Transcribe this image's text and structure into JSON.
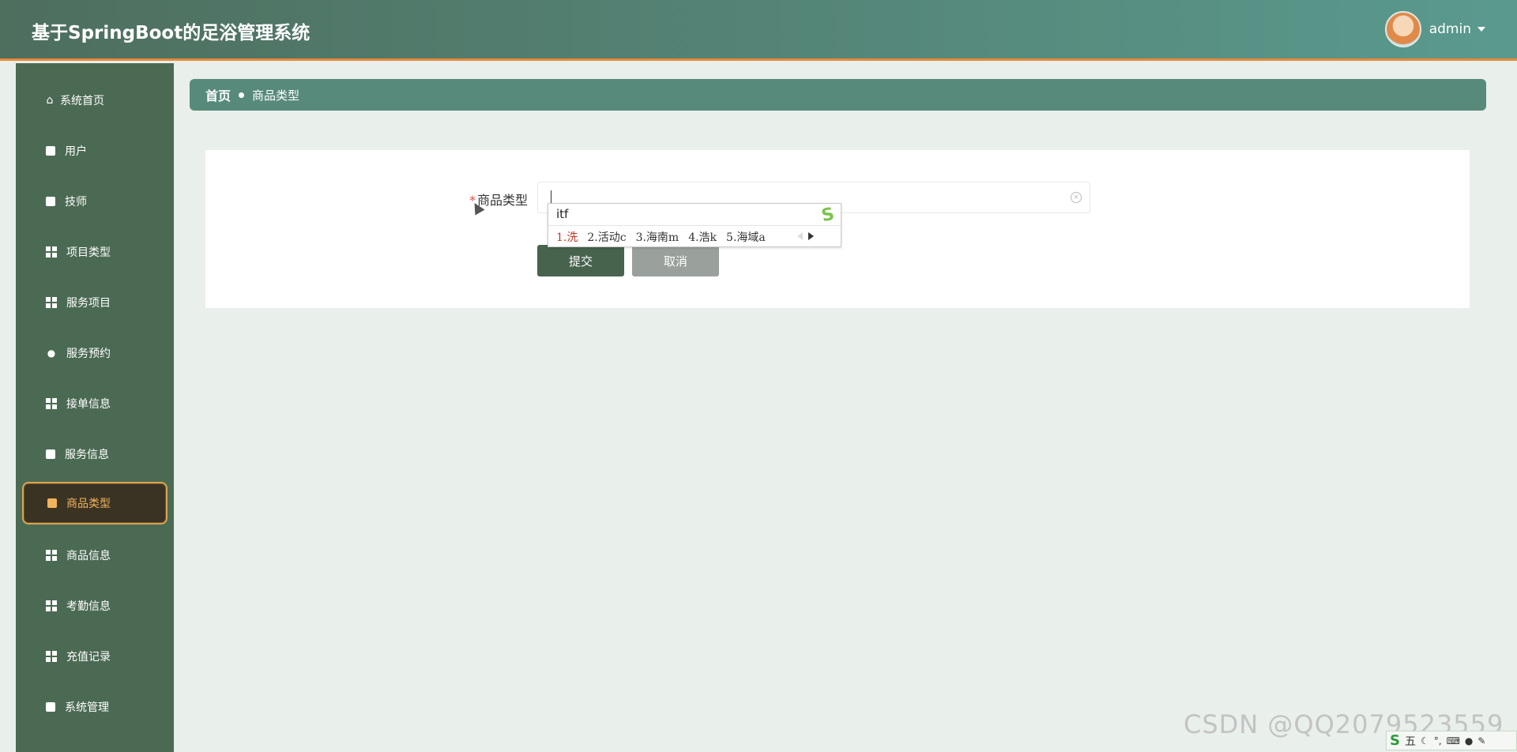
{
  "header": {
    "title": "基于SpringBoot的足浴管理系统",
    "username": "admin"
  },
  "sidebar": {
    "items": [
      {
        "label": "系统首页",
        "icon": "home-icon"
      },
      {
        "label": "用户",
        "icon": "chat-icon"
      },
      {
        "label": "技师",
        "icon": "briefcase-icon"
      },
      {
        "label": "项目类型",
        "icon": "grid-icon"
      },
      {
        "label": "服务项目",
        "icon": "grid-icon"
      },
      {
        "label": "服务预约",
        "icon": "bulb-icon"
      },
      {
        "label": "接单信息",
        "icon": "grid-icon"
      },
      {
        "label": "服务信息",
        "icon": "clipboard-icon"
      },
      {
        "label": "商品类型",
        "icon": "box-icon",
        "active": true
      },
      {
        "label": "商品信息",
        "icon": "grid-icon"
      },
      {
        "label": "考勤信息",
        "icon": "grid-icon"
      },
      {
        "label": "充值记录",
        "icon": "grid-icon"
      },
      {
        "label": "系统管理",
        "icon": "thumb-icon"
      }
    ]
  },
  "breadcrumb": {
    "home": "首页",
    "current": "商品类型"
  },
  "form": {
    "field_label": "商品类型",
    "required_mark": "*",
    "input_value": "",
    "submit_label": "提交",
    "cancel_label": "取消"
  },
  "ime_popup": {
    "composition": "itf",
    "candidates": [
      "1.洗",
      "2.活动c",
      "3.海南m",
      "4.浩k",
      "5.海域a"
    ]
  },
  "ime_toolbar": {
    "mode": "五"
  },
  "watermark": "CSDN @QQ2079523559",
  "colors": {
    "header_start": "#4e6e5e",
    "header_end": "#5a9a8e",
    "accent_orange": "#e68a3a",
    "sidebar_bg": "#4b6a53",
    "active_text": "#f2b35c",
    "submit_bg": "#47634e",
    "cancel_bg": "#9aa09c"
  }
}
